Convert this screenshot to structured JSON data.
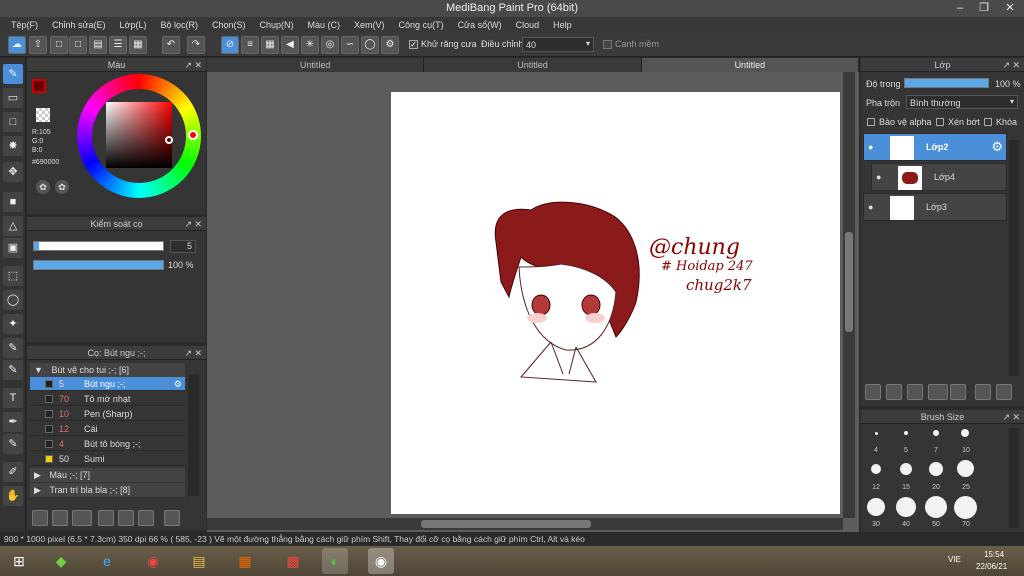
{
  "app": {
    "title": "MediBang Paint Pro (64bit)"
  },
  "menu": [
    "Tệp(F)",
    "Chỉnh sửa(E)",
    "Lớp(L)",
    "Bộ lọc(R)",
    "Chọn(S)",
    "Chụp(N)",
    "Màu (C)",
    "Xem(V)",
    "Công cụ(T)",
    "Cửa sổ(W)",
    "Cloud",
    "Help"
  ],
  "toolbar": {
    "antialias_label": "Khử răng cưa",
    "adjust_label": "Điều chỉnh",
    "adjust_value": "40",
    "smooth_label": "Canh mềm"
  },
  "color_panel": {
    "title": "Màu",
    "r": "R:105",
    "g": "G:0",
    "b": "B:0",
    "hex": "#690000",
    "fg_color": "#690000"
  },
  "brush_control": {
    "title": "Kiểm soát cọ",
    "size": "5",
    "opacity": "100 %",
    "size_fraction": 0.04,
    "opacity_fraction": 1.0
  },
  "brush_panel": {
    "title": "Cọ: Bút ngu ;-;",
    "group1": "Bút vẽ cho tui ;-; [6]",
    "brushes": [
      {
        "size": "5",
        "name": "Bút ngu ;-;",
        "selected": true
      },
      {
        "size": "70",
        "name": "Tô mờ nhạt"
      },
      {
        "size": "10",
        "name": "Pen (Sharp)"
      },
      {
        "size": "12",
        "name": "Cái"
      },
      {
        "size": "4",
        "name": "Bút tô bóng ;-;"
      },
      {
        "size": "50",
        "name": "Sumi",
        "yellow": true
      }
    ],
    "group2": "Màu ;-; [7]",
    "group3": "Tran trí bla bla ;-; [8]"
  },
  "tabs": [
    "Untitled",
    "Untitled",
    "Untitled"
  ],
  "canvas_text": {
    "line1": "@chung",
    "line2": "# Hoidap 247",
    "line3": "chug2k7"
  },
  "layers_panel": {
    "title": "Lớp",
    "opacity_label": "Độ trong",
    "opacity_value": "100 %",
    "blend_label": "Pha trộn",
    "blend_value": "Bình thường",
    "protect_alpha": "Bảo vệ alpha",
    "clip": "Xén bớt",
    "lock": "Khóa",
    "layers": [
      {
        "name": "Lớp2",
        "selected": true
      },
      {
        "name": "Lớp4"
      },
      {
        "name": "Lớp3"
      }
    ]
  },
  "brush_size_panel": {
    "title": "Brush Size",
    "sizes": [
      "4",
      "5",
      "7",
      "10",
      "12",
      "15",
      "20",
      "25",
      "30",
      "40",
      "50",
      "70"
    ]
  },
  "status": {
    "text": "900 * 1000 pixel   (6.5 * 7.3cm)   350 dpi   66 %   ( 585, -23 )   Vẽ một đường thẳng bằng cách giữ phím Shift, Thay đổi cỡ cọ bằng cách giữ phím Ctrl, Alt và kéo"
  },
  "taskbar": {
    "lang": "VIE",
    "time": "15:54",
    "date": "22/06/21"
  }
}
